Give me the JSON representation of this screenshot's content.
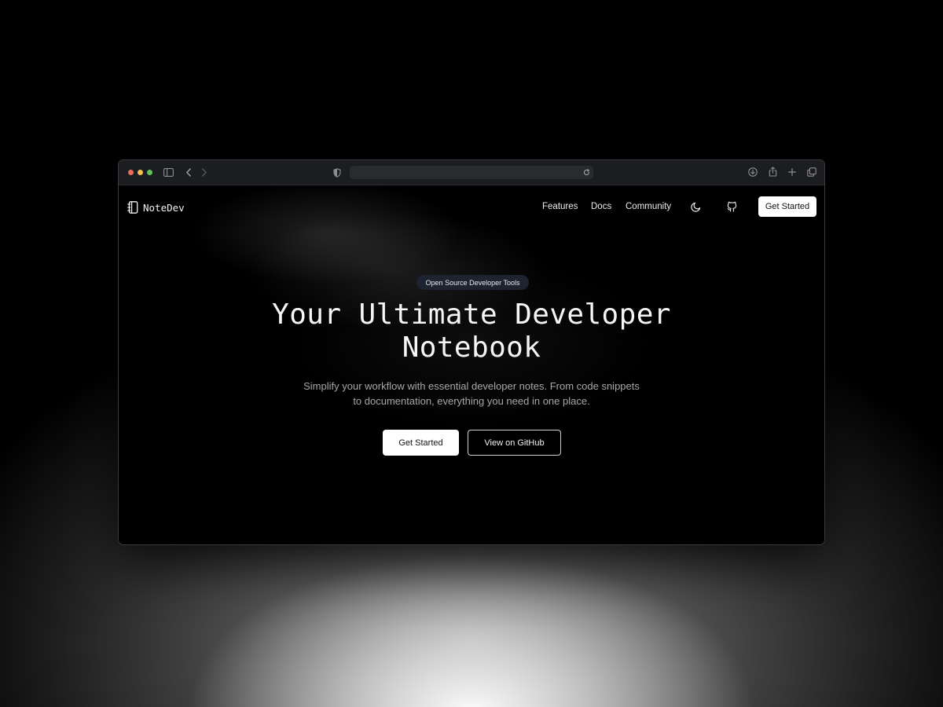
{
  "colors": {
    "close": "#ed6a5e",
    "minimize": "#f5bf4f",
    "maximize": "#61c454",
    "chrome_bg": "#1c1d20",
    "page_bg": "#000000",
    "badge_bg": "#1d2330",
    "primary_button_bg": "#ffffff"
  },
  "browser": {
    "icons": [
      "sidebar-icon",
      "back-icon",
      "forward-icon",
      "shield-icon",
      "reload-icon",
      "download-icon",
      "share-icon",
      "new-tab-icon",
      "tabs-overview-icon"
    ],
    "address": ""
  },
  "site": {
    "brand": {
      "name": "NoteDev",
      "icon": "notebook-icon"
    },
    "nav": {
      "links": [
        "Features",
        "Docs",
        "Community"
      ],
      "theme_icon": "moon-icon",
      "github_icon": "github-icon",
      "cta": "Get Started"
    },
    "hero": {
      "badge": "Open Source Developer Tools",
      "title_line1": "Your Ultimate Developer",
      "title_line2": "Notebook",
      "subtitle_line1": "Simplify your workflow with essential developer notes. From code snippets",
      "subtitle_line2": "to documentation, everything you need in one place.",
      "primary_button": "Get Started",
      "secondary_button": "View on GitHub"
    }
  }
}
